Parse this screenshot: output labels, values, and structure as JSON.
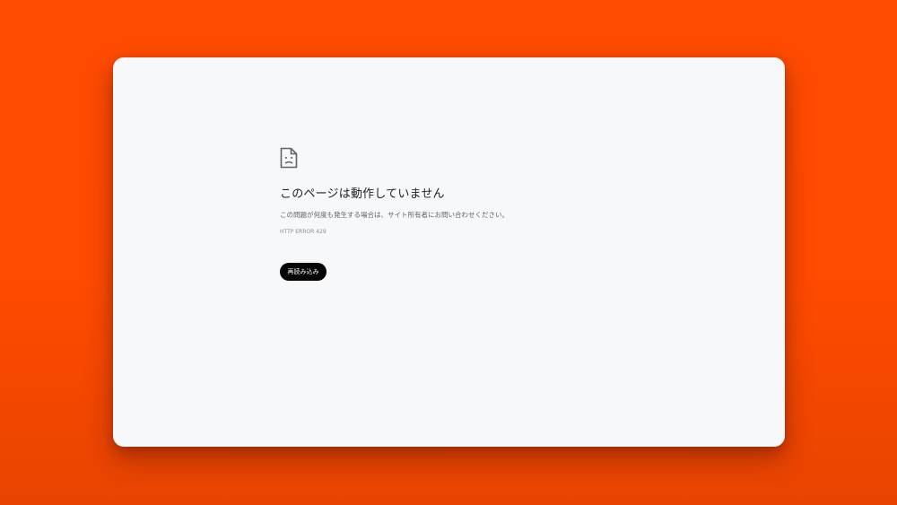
{
  "background_color": "#ff4b00",
  "error_page": {
    "icon": "sad-page-icon",
    "title": "このページは動作していません",
    "description": "この問題が何度も発生する場合は、サイト所有者にお問い合わせください。",
    "error_code": "HTTP ERROR 429",
    "reload_button_label": "再読み込み"
  }
}
